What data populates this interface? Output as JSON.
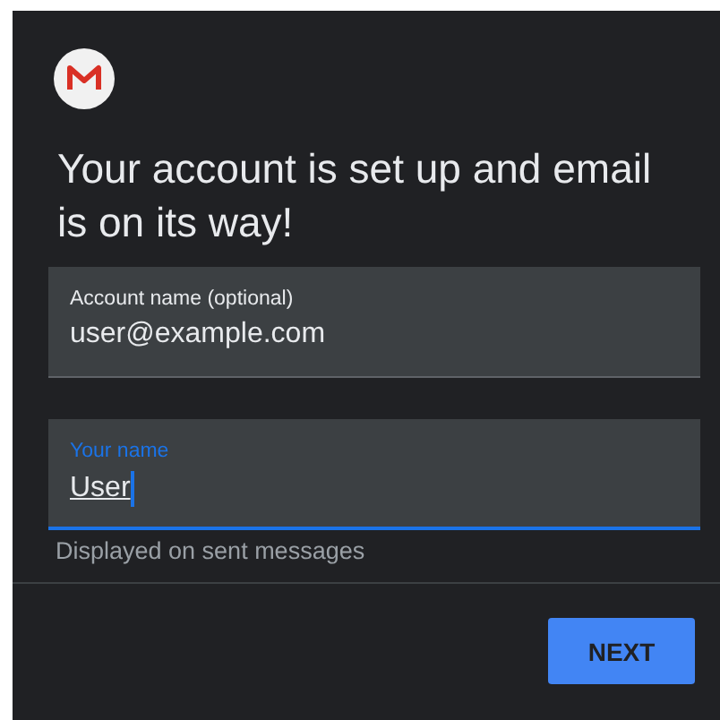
{
  "heading": "Your account is set up and email is on its way!",
  "fields": [
    {
      "label": "Account name (optional)",
      "value": "user@example.com",
      "focused": false
    },
    {
      "label": "Your name",
      "value": "User",
      "focused": true
    }
  ],
  "helper_text": "Displayed on sent messages",
  "buttons": [
    "NEXT"
  ]
}
